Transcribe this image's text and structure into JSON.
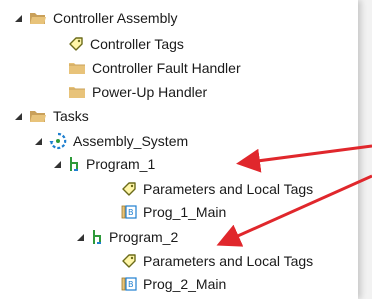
{
  "tree": {
    "controller_assembly": {
      "label": "Controller Assembly",
      "icon": "folder-open-icon",
      "children": {
        "controller_tags": {
          "label": "Controller Tags",
          "icon": "tag-icon"
        },
        "fault_handler": {
          "label": "Controller Fault Handler",
          "icon": "folder-icon"
        },
        "powerup_handler": {
          "label": "Power-Up Handler",
          "icon": "folder-icon"
        }
      }
    },
    "tasks": {
      "label": "Tasks",
      "icon": "folder-open-icon",
      "assembly_system": {
        "label": "Assembly_System",
        "icon": "continuous-task-icon",
        "programs": [
          {
            "label": "Program_1",
            "icon": "program-icon",
            "params_label": "Parameters and Local Tags",
            "routine_label": "Prog_1_Main"
          },
          {
            "label": "Program_2",
            "icon": "program-icon",
            "params_label": "Parameters and Local Tags",
            "routine_label": "Prog_2_Main"
          }
        ]
      }
    }
  },
  "colors": {
    "folder": "#e8c37a",
    "folder_dark": "#c9a05a",
    "tag_outline": "#6b6b1a",
    "arrow": "#e0272c",
    "task_blue": "#1e7fd0",
    "program_green": "#2e9a3a"
  }
}
